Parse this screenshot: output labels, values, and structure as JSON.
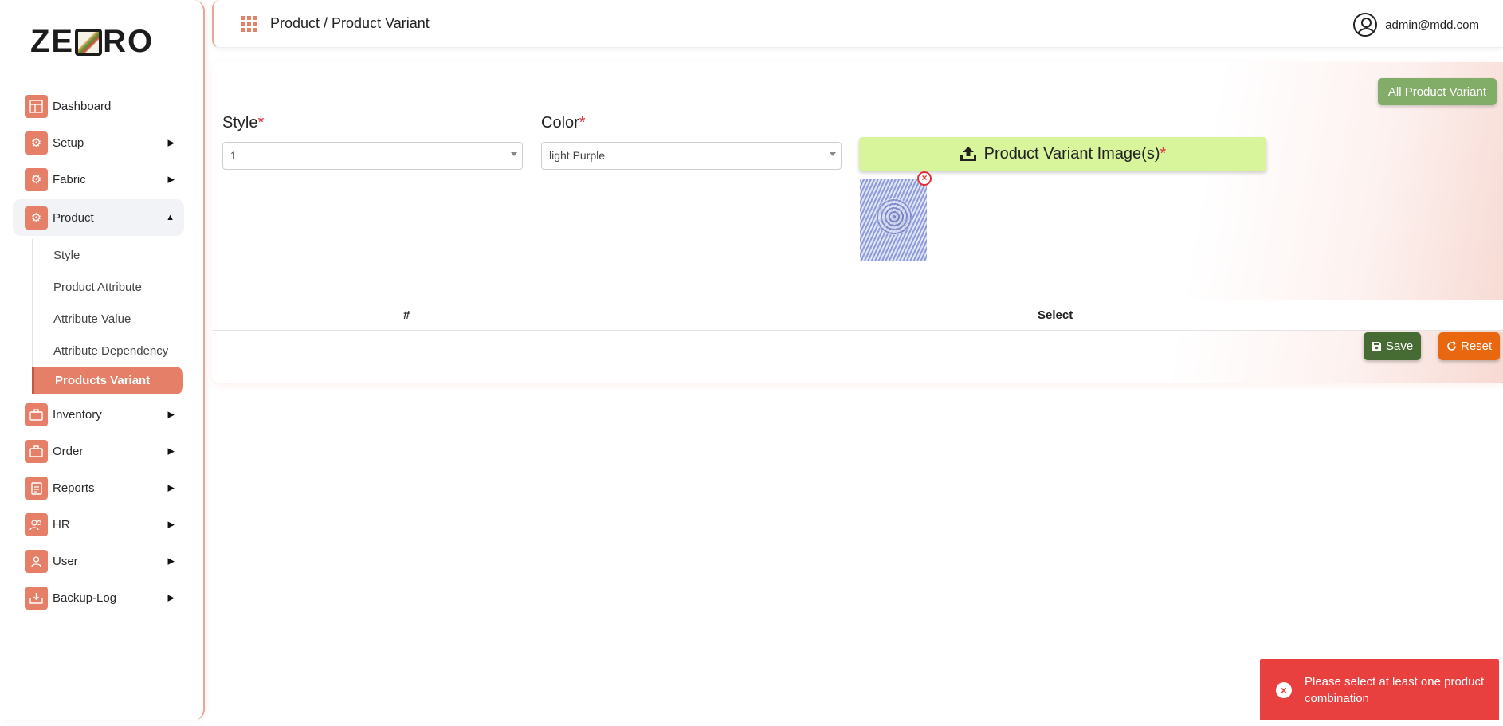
{
  "app": {
    "logo_text_left": "ZE",
    "logo_text_right": "RO"
  },
  "sidebar": {
    "items": [
      {
        "label": "Dashboard",
        "icon": "dashboard-icon"
      },
      {
        "label": "Setup",
        "icon": "gear-icon"
      },
      {
        "label": "Fabric",
        "icon": "gear-icon"
      },
      {
        "label": "Product",
        "icon": "gear-icon"
      },
      {
        "label": "Inventory",
        "icon": "briefcase-icon"
      },
      {
        "label": "Order",
        "icon": "briefcase-icon"
      },
      {
        "label": "Reports",
        "icon": "clipboard-icon"
      },
      {
        "label": "HR",
        "icon": "users-icon"
      },
      {
        "label": "User",
        "icon": "user-group-icon"
      },
      {
        "label": "Backup-Log",
        "icon": "inbox-icon"
      }
    ],
    "product_submenu": [
      {
        "label": "Style"
      },
      {
        "label": "Product Attribute"
      },
      {
        "label": "Attribute Value"
      },
      {
        "label": "Attribute Dependency"
      },
      {
        "label": "Products Variant"
      }
    ]
  },
  "header": {
    "breadcrumb": "Product / Product Variant",
    "user_email": "admin@mdd.com"
  },
  "form": {
    "all_variant_button": "All Product Variant",
    "style_label": "Style",
    "style_value": "1",
    "color_label": "Color",
    "color_value": "light Purple",
    "required_mark": "*",
    "upload_label": "Product Variant Image(s)",
    "remove_image": "×"
  },
  "table": {
    "columns": [
      "#",
      "Select"
    ]
  },
  "actions": {
    "save": "Save",
    "reset": "Reset"
  },
  "toast": {
    "message": "Please select at least one product combination",
    "icon": "×"
  },
  "colors": {
    "accent": "#e67f67",
    "save": "#476c33",
    "reset": "#e8670f",
    "upload": "#d8f59c",
    "all_variant": "#82ad68",
    "error": "#e83f3f"
  }
}
